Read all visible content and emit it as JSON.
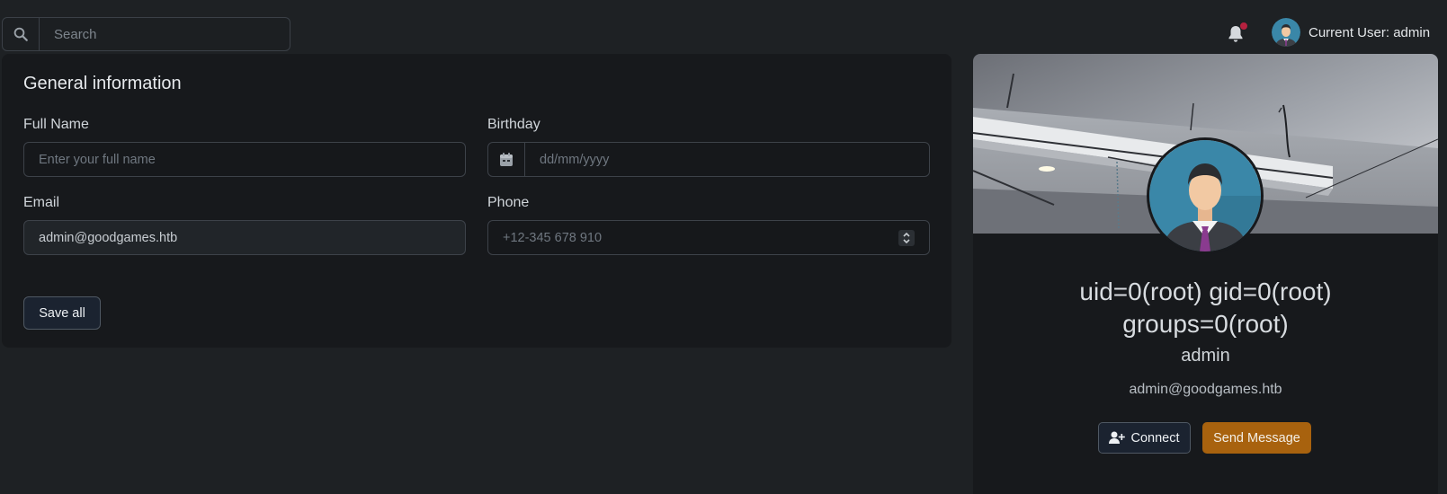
{
  "search": {
    "placeholder": "Search"
  },
  "header": {
    "user_label": "Current User: admin"
  },
  "form": {
    "title": "General information",
    "full_name": {
      "label": "Full Name",
      "placeholder": "Enter your full name"
    },
    "birthday": {
      "label": "Birthday",
      "placeholder": "dd/mm/yyyy"
    },
    "email": {
      "label": "Email",
      "value": "admin@goodgames.htb"
    },
    "phone": {
      "label": "Phone",
      "placeholder": "+12-345 678 910"
    },
    "save_label": "Save all"
  },
  "profile": {
    "name_line1": "uid=0(root) gid=0(root)",
    "name_line2": "groups=0(root)",
    "username": "admin",
    "email": "admin@goodgames.htb",
    "connect_label": "Connect",
    "message_label": "Send Message"
  },
  "colors": {
    "background": "#1e2124",
    "card": "#17191c",
    "accent_orange": "#a8620e",
    "notification_dot": "#b5213f"
  },
  "icons": [
    "search-icon",
    "bell-icon",
    "calendar-icon",
    "spinner-icon",
    "user-plus-icon"
  ]
}
